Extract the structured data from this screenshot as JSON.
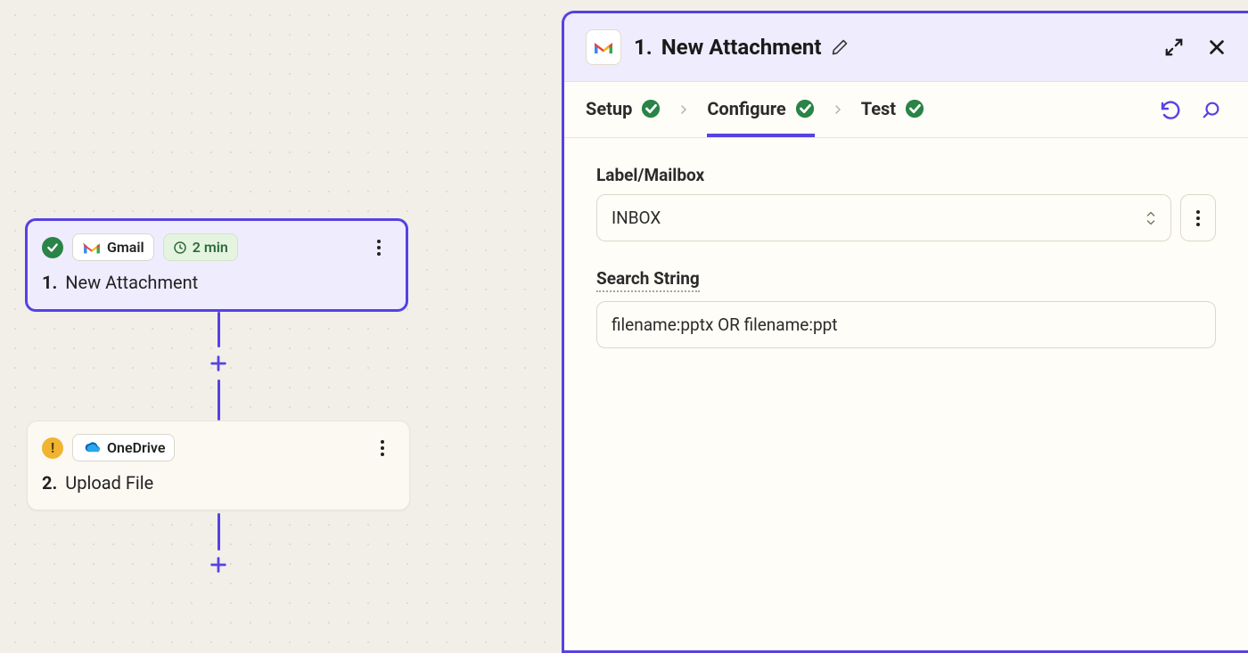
{
  "flow": {
    "node1": {
      "service": "Gmail",
      "interval": "2 min",
      "index": "1.",
      "title": "New Attachment"
    },
    "node2": {
      "service": "OneDrive",
      "index": "2.",
      "title": "Upload File"
    }
  },
  "panel": {
    "title_index": "1.",
    "title_text": "New Attachment",
    "tabs": {
      "setup": "Setup",
      "configure": "Configure",
      "test": "Test"
    },
    "fields": {
      "label_mailbox": {
        "label": "Label/Mailbox",
        "value": "INBOX"
      },
      "search_string": {
        "label": "Search String",
        "value": "filename:pptx OR filename:ppt"
      }
    }
  }
}
